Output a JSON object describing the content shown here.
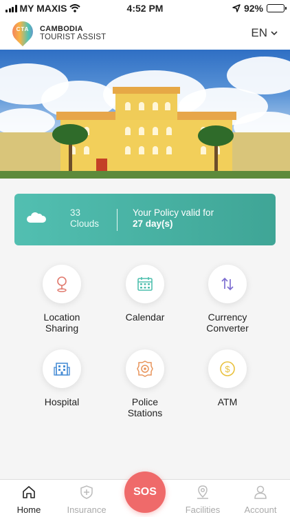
{
  "status_bar": {
    "carrier": "MY MAXIS",
    "time": "4:52 PM",
    "battery_percent": "92%",
    "battery_level": 0.92,
    "icons": [
      "signal-icon",
      "wifi-icon",
      "location-arrow-icon",
      "battery-icon"
    ]
  },
  "header": {
    "logo_text": "CTA",
    "brand_line1": "CAMBODIA",
    "brand_line2": "TOURIST ASSIST",
    "language": "EN"
  },
  "weather": {
    "temperature": "33",
    "condition": "Clouds"
  },
  "policy": {
    "label": "Your Policy valid for",
    "days": "27 day(s)"
  },
  "services": [
    {
      "label_line1": "Location",
      "label_line2": "Sharing",
      "icon": "location-pin-icon",
      "color": "#e0786c"
    },
    {
      "label_line1": "Calendar",
      "label_line2": "",
      "icon": "calendar-icon",
      "color": "#4fbfae"
    },
    {
      "label_line1": "Currency",
      "label_line2": "Converter",
      "icon": "swap-arrows-icon",
      "color": "#7d6ed1"
    },
    {
      "label_line1": "Hospital",
      "label_line2": "",
      "icon": "hospital-building-icon",
      "color": "#4b8fd6"
    },
    {
      "label_line1": "Police",
      "label_line2": "Stations",
      "icon": "police-badge-icon",
      "color": "#e8945a"
    },
    {
      "label_line1": "ATM",
      "label_line2": "",
      "icon": "dollar-coin-icon",
      "color": "#e9c13c"
    }
  ],
  "bottom_nav": {
    "home": "Home",
    "insurance": "Insurance",
    "sos": "SOS",
    "facilities": "Facilities",
    "account": "Account",
    "active": "home"
  }
}
